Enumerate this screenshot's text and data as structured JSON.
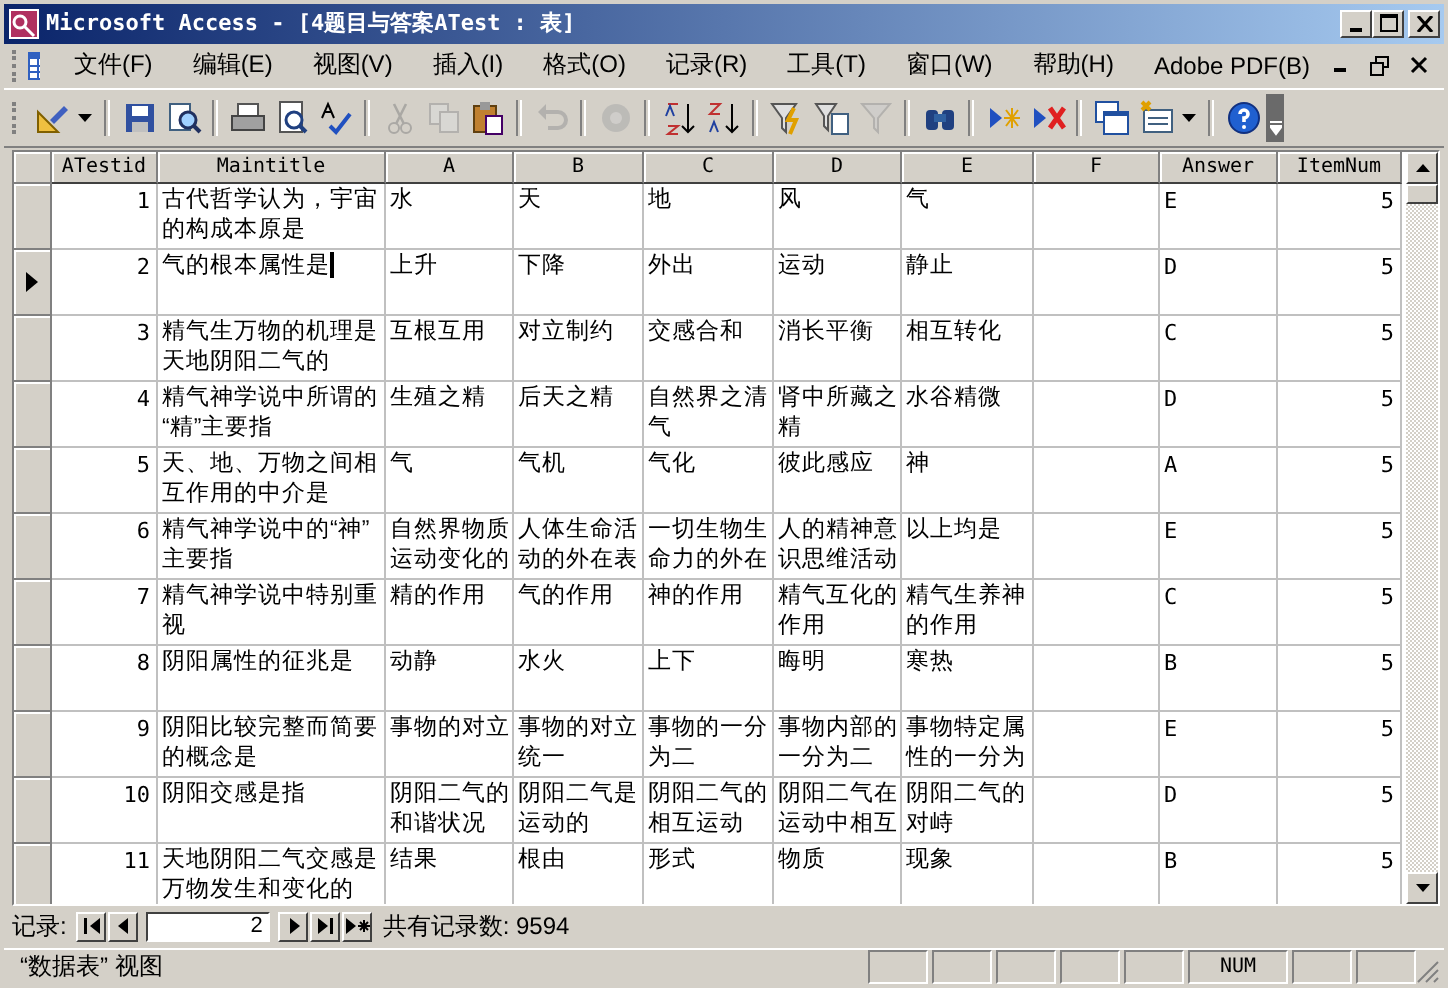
{
  "window": {
    "title": "Microsoft Access - [4题目与答案ATest : 表]"
  },
  "menu": [
    "文件(F)",
    "编辑(E)",
    "视图(V)",
    "插入(I)",
    "格式(O)",
    "记录(R)",
    "工具(T)",
    "窗口(W)",
    "帮助(H)",
    "Adobe PDF(B)"
  ],
  "toolbar": [
    {
      "kind": "design",
      "disabled": false
    },
    {
      "kind": "save",
      "disabled": false
    },
    {
      "kind": "search",
      "disabled": false
    },
    {
      "kind": "print",
      "disabled": false
    },
    {
      "kind": "preview",
      "disabled": false
    },
    {
      "kind": "spelling",
      "disabled": false
    },
    {
      "kind": "cut",
      "disabled": true
    },
    {
      "kind": "copy",
      "disabled": true
    },
    {
      "kind": "paste",
      "disabled": false
    },
    {
      "kind": "undo",
      "disabled": true
    },
    {
      "kind": "object",
      "disabled": true
    },
    {
      "kind": "sortasc",
      "disabled": false
    },
    {
      "kind": "sortdesc",
      "disabled": false
    },
    {
      "kind": "filtersel",
      "disabled": false
    },
    {
      "kind": "filterform",
      "disabled": false
    },
    {
      "kind": "filter",
      "disabled": true
    },
    {
      "kind": "find",
      "disabled": false
    },
    {
      "kind": "newrec",
      "disabled": false
    },
    {
      "kind": "delrec",
      "disabled": false
    },
    {
      "kind": "dbwin",
      "disabled": false
    },
    {
      "kind": "newobj",
      "disabled": false
    },
    {
      "kind": "help",
      "disabled": false
    }
  ],
  "table": {
    "columns": [
      "ATestid",
      "Maintitle",
      "A",
      "B",
      "C",
      "D",
      "E",
      "F",
      "Answer",
      "ItemNum"
    ],
    "rows": [
      {
        "current": false,
        "cells": [
          "1",
          "古代哲学认为，宇宙的构成本原是",
          "水",
          "天",
          "地",
          "风",
          "气",
          "",
          "E",
          "5"
        ]
      },
      {
        "current": true,
        "cells": [
          "2",
          "气的根本属性是",
          "上升",
          "下降",
          "外出",
          "运动",
          "静止",
          "",
          "D",
          "5"
        ]
      },
      {
        "current": false,
        "cells": [
          "3",
          "精气生万物的机理是天地阴阳二气的",
          "互根互用",
          "对立制约",
          "交感合和",
          "消长平衡",
          "相互转化",
          "",
          "C",
          "5"
        ]
      },
      {
        "current": false,
        "cells": [
          "4",
          "精气神学说中所谓的“精”主要指",
          "生殖之精",
          "后天之精",
          "自然界之清气",
          "肾中所藏之精",
          "水谷精微",
          "",
          "D",
          "5"
        ]
      },
      {
        "current": false,
        "cells": [
          "5",
          "天、地、万物之间相互作用的中介是",
          "气",
          "气机",
          "气化",
          "彼此感应",
          "神",
          "",
          "A",
          "5"
        ]
      },
      {
        "current": false,
        "cells": [
          "6",
          "精气神学说中的“神”主要指",
          "自然界物质运动变化的",
          "人体生命活动的外在表",
          "一切生物生命力的外在",
          "人的精神意识思维活动",
          "以上均是",
          "",
          "E",
          "5"
        ]
      },
      {
        "current": false,
        "cells": [
          "7",
          "精气神学说中特别重视",
          "精的作用",
          "气的作用",
          "神的作用",
          "精气互化的作用",
          "精气生养神的作用",
          "",
          "C",
          "5"
        ]
      },
      {
        "current": false,
        "cells": [
          "8",
          "阴阳属性的征兆是",
          "动静",
          "水火",
          "上下",
          "晦明",
          "寒热",
          "",
          "B",
          "5"
        ]
      },
      {
        "current": false,
        "cells": [
          "9",
          "阴阳比较完整而简要的概念是",
          "事物的对立",
          "事物的对立统一",
          "事物的一分为二",
          "事物内部的一分为二",
          "事物特定属性的一分为",
          "",
          "E",
          "5"
        ]
      },
      {
        "current": false,
        "cells": [
          "10",
          "阴阳交感是指",
          "阴阳二气的和谐状况",
          "阴阳二气是运动的",
          "阴阳二气的相互运动",
          "阴阳二气在运动中相互",
          "阴阳二气的对峙",
          "",
          "D",
          "5"
        ]
      },
      {
        "current": false,
        "cells": [
          "11",
          "天地阴阳二气交感是万物发生和变化的",
          "结果",
          "根由",
          "形式",
          "物质",
          "现象",
          "",
          "B",
          "5"
        ]
      }
    ]
  },
  "navigation": {
    "label": "记录:",
    "current": "2",
    "total": "共有记录数: 9594"
  },
  "status_bar": {
    "text": "“数据表” 视图",
    "num": "NUM"
  }
}
